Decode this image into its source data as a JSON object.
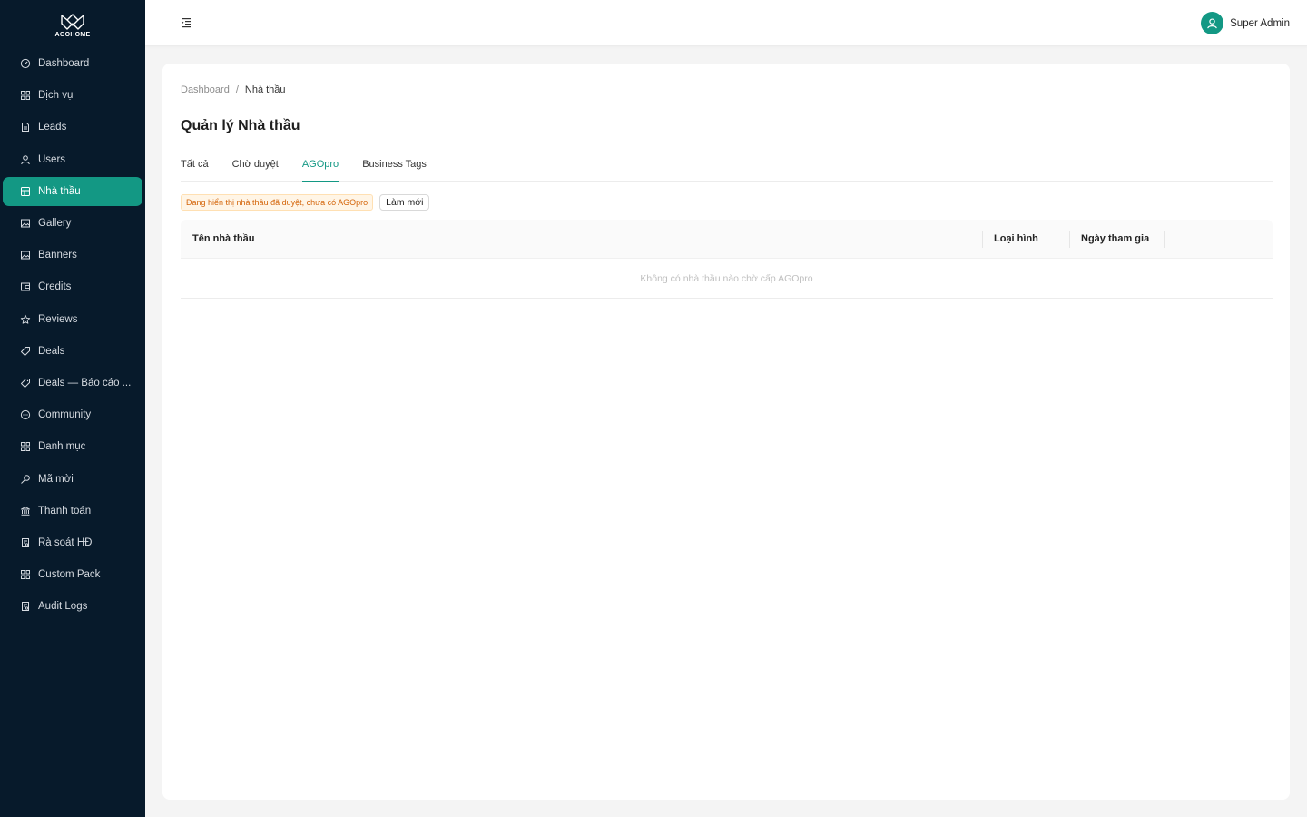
{
  "brand": {
    "logo_text": "AGOHOME"
  },
  "sidebar": {
    "items": [
      {
        "label": "Dashboard",
        "icon": "dashboard-icon"
      },
      {
        "label": "Dịch vụ",
        "icon": "grid-icon"
      },
      {
        "label": "Leads",
        "icon": "file-icon"
      },
      {
        "label": "Users",
        "icon": "user-icon"
      },
      {
        "label": "Nhà thầu",
        "icon": "store-icon",
        "active": true
      },
      {
        "label": "Gallery",
        "icon": "image-icon"
      },
      {
        "label": "Banners",
        "icon": "image-icon"
      },
      {
        "label": "Credits",
        "icon": "wallet-icon"
      },
      {
        "label": "Reviews",
        "icon": "star-icon"
      },
      {
        "label": "Deals",
        "icon": "tag-icon"
      },
      {
        "label": "Deals — Báo cáo ...",
        "icon": "tag-icon"
      },
      {
        "label": "Community",
        "icon": "chat-icon"
      },
      {
        "label": "Danh mục",
        "icon": "grid-icon"
      },
      {
        "label": "Mã mời",
        "icon": "key-icon"
      },
      {
        "label": "Thanh toán",
        "icon": "bank-icon"
      },
      {
        "label": "Rà soát HĐ",
        "icon": "audit-icon"
      },
      {
        "label": "Custom Pack",
        "icon": "grid-icon"
      },
      {
        "label": "Audit Logs",
        "icon": "audit-icon"
      }
    ]
  },
  "header": {
    "user_name": "Super Admin"
  },
  "breadcrumb": {
    "root": "Dashboard",
    "separator": "/",
    "current": "Nhà thầu"
  },
  "page": {
    "title": "Quản lý Nhà thầu"
  },
  "tabs": [
    {
      "label": "Tất cả"
    },
    {
      "label": "Chờ duyệt"
    },
    {
      "label": "AGOpro",
      "active": true
    },
    {
      "label": "Business Tags"
    }
  ],
  "notice": {
    "tag": "Đang hiển thị nhà thầu đã duyệt, chưa có AGOpro",
    "refresh_label": "Làm mới"
  },
  "table": {
    "columns": [
      "Tên nhà thầu",
      "Loại hình",
      "Ngày tham gia"
    ],
    "empty_text": "Không có nhà thầu nào chờ cấp AGOpro"
  },
  "colors": {
    "sidebar_bg": "#071a2b",
    "accent": "#139884",
    "notice_text": "#d4650a"
  }
}
